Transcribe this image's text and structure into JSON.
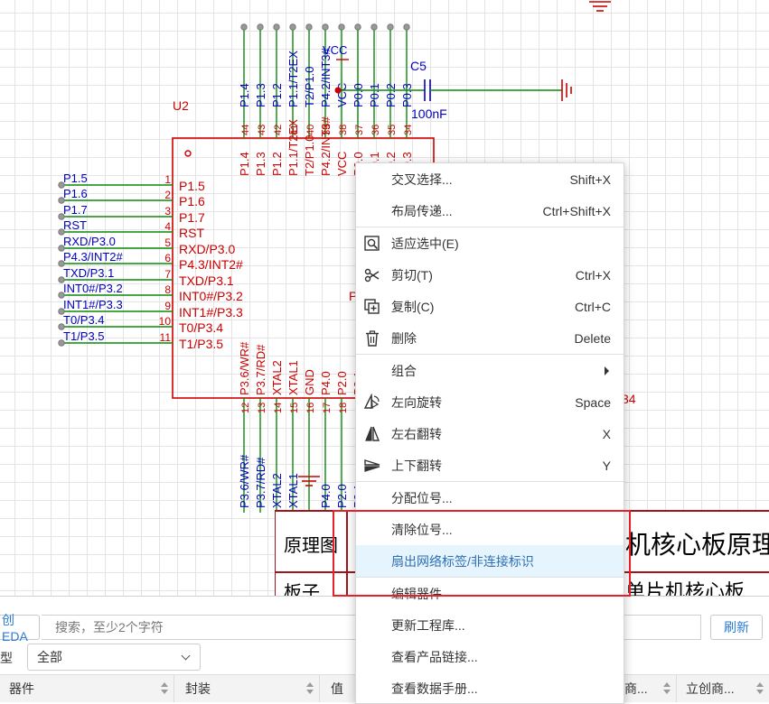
{
  "schematic": {
    "designator": "U2",
    "cap_name": "C5",
    "cap_value": "100nF",
    "vcc_label": "VCC",
    "top_net_labels": [
      "P1.4",
      "P1.3",
      "P1.2",
      "P1.1/T2EX",
      "T2/P1.0",
      "P4.2/INT3#",
      "VCC",
      "P0.0",
      "P0.1",
      "P0.2",
      "P0.3"
    ],
    "top_pin_numbers": [
      "44",
      "43",
      "42",
      "41",
      "40",
      "39",
      "38",
      "37",
      "36",
      "35",
      "34"
    ],
    "top_pin_names": [
      "P1.4",
      "P1.3",
      "P1.2",
      "P1.1/T2EX",
      "T2/P1.0",
      "P4.2/INT3#",
      "VCC",
      "P0.0",
      "P0.1",
      "P0.2",
      "P0.3"
    ],
    "left_net_labels": [
      "P1.5",
      "P1.6",
      "P1.7",
      "RST",
      "RXD/P3.0",
      "P4.3/INT2#",
      "TXD/P3.1",
      "INT0#/P3.2",
      "INT1#/P3.3",
      "T0/P3.4",
      "T1/P3.5"
    ],
    "left_pin_numbers": [
      "1",
      "2",
      "3",
      "4",
      "5",
      "6",
      "7",
      "8",
      "9",
      "10",
      "11"
    ],
    "left_pin_names": [
      "P1.5",
      "P1.6",
      "P1.7",
      "RST",
      "RXD/P3.0",
      "P4.3/INT2#",
      "TXD/P3.1",
      "INT0#/P3.2",
      "INT1#/P3.3",
      "T0/P3.4",
      "T1/P3.5"
    ],
    "bottom_pin_names": [
      "P3.6/WR#",
      "P3.7/RD#",
      "XTAL2",
      "XTAL1",
      "GND",
      "P4.0",
      "P2.0",
      "P2.1"
    ],
    "bottom_pin_numbers": [
      "12",
      "13",
      "14",
      "15",
      "16",
      "17",
      "18",
      "19"
    ],
    "bottom_net_labels": [
      "P3.6/WR#",
      "P3.7/RD#",
      "XTAL2",
      "XTAL1",
      "P4.0",
      "P2.0",
      "P2.1"
    ],
    "partial_right_letter": "P",
    "partial_right_number": "34",
    "title_block": {
      "cell1": "原理图",
      "cell2": "机核心板原理",
      "cell3": "板子",
      "cell4": "单片机核心板"
    }
  },
  "context_menu": {
    "items": [
      {
        "label": "交叉选择...",
        "shortcut": "Shift+X"
      },
      {
        "label": "布局传递...",
        "shortcut": "Ctrl+Shift+X"
      },
      {
        "label": "适应选中(E)",
        "shortcut": ""
      },
      {
        "label": "剪切(T)",
        "shortcut": "Ctrl+X"
      },
      {
        "label": "复制(C)",
        "shortcut": "Ctrl+C"
      },
      {
        "label": "删除",
        "shortcut": "Delete"
      },
      {
        "label": "组合",
        "shortcut": ""
      },
      {
        "label": "左向旋转",
        "shortcut": "Space"
      },
      {
        "label": "左右翻转",
        "shortcut": "X"
      },
      {
        "label": "上下翻转",
        "shortcut": "Y"
      },
      {
        "label": "分配位号...",
        "shortcut": ""
      },
      {
        "label": "清除位号...",
        "shortcut": ""
      },
      {
        "label": "扇出网络标签/非连接标识",
        "shortcut": ""
      },
      {
        "label": "编辑器件",
        "shortcut": ""
      },
      {
        "label": "更新工程库...",
        "shortcut": ""
      },
      {
        "label": "查看产品链接...",
        "shortcut": ""
      },
      {
        "label": "查看数据手册...",
        "shortcut": ""
      }
    ]
  },
  "library_panel": {
    "eda_tab": "创EDA",
    "search_placeholder": "搜索，至少2个字符",
    "refresh_label": "刷新",
    "type_label": "类型",
    "type_value": "全部",
    "columns": [
      "器件",
      "封装",
      "值",
      "商...",
      "立创商..."
    ]
  },
  "colors": {
    "red": "#cc0000",
    "blue": "#0000c0",
    "wire": "#0a8a0a",
    "highlight": "#e8202a",
    "accent": "#2a7ad2"
  }
}
